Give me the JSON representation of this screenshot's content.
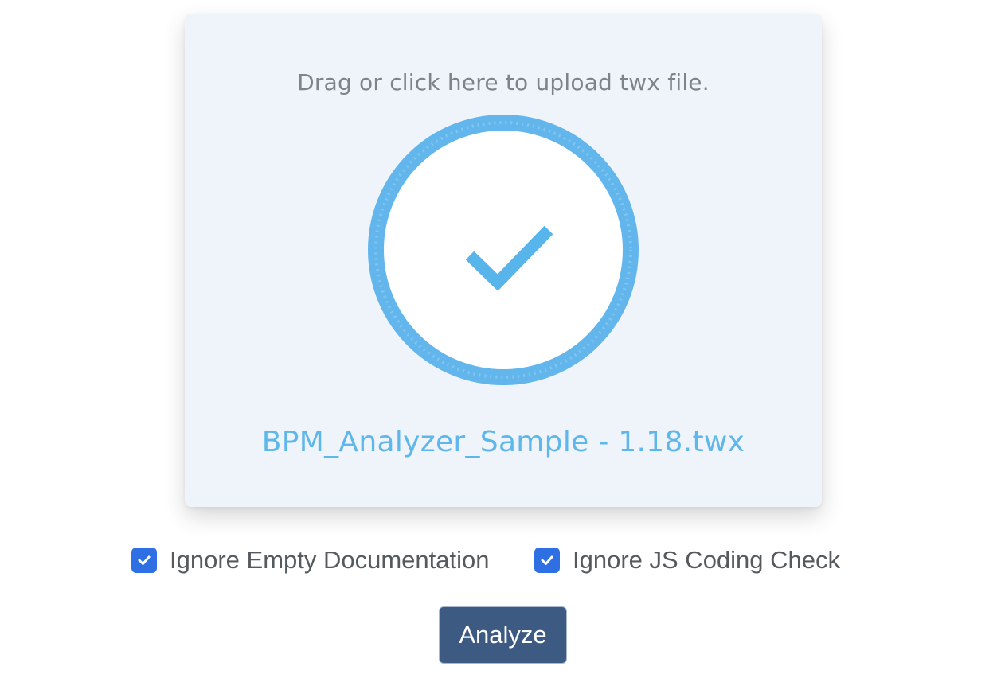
{
  "upload": {
    "prompt": "Drag or click here to upload twx file.",
    "status_icon": "check-circle-icon",
    "filename": "BPM_Analyzer_Sample - 1.18.twx",
    "accent_color": "#5db7ea"
  },
  "options": [
    {
      "label": "Ignore Empty Documentation",
      "checked": true,
      "icon": "checkmark-icon"
    },
    {
      "label": "Ignore JS Coding Check",
      "checked": true,
      "icon": "checkmark-icon"
    }
  ],
  "actions": {
    "analyze_label": "Analyze"
  },
  "colors": {
    "checkbox": "#2f6fe4",
    "button": "#3d5b82",
    "dropzone_bg": "#eff4fb"
  }
}
